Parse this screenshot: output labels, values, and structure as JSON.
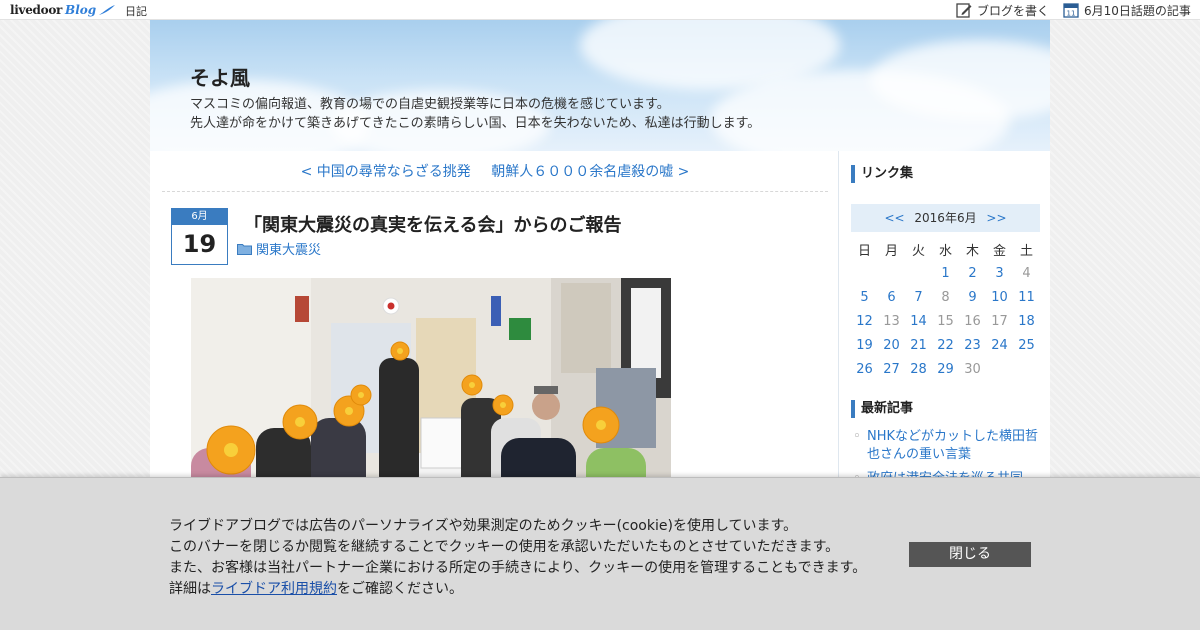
{
  "topbar": {
    "brand_livedoor": "livedoor",
    "brand_blog": "Blog",
    "nav_diary": "日記",
    "write_label": "ブログを書く",
    "topic_label": "6月10日話題の記事",
    "topic_icon_day": "11"
  },
  "header": {
    "title": "そよ風",
    "desc_line1": "マスコミの偏向報道、教育の場での自虐史観授業等に日本の危機を感じています。",
    "desc_line2": "先人達が命をかけて築きあげてきたこの素晴らしい国、日本を失わないため、私達は行動します。"
  },
  "pager": {
    "prev": "< 中国の尋常ならざる挑発",
    "next": "朝鮮人６０００余名虐殺の嘘 >"
  },
  "article": {
    "month": "6月",
    "day": "19",
    "title": "「関東大震災の真実を伝える会」からのご報告",
    "category": "関東大震災"
  },
  "sidebar": {
    "links_heading": "リンク集",
    "calendar": {
      "prev": "<<",
      "title": "2016年6月",
      "next": ">>",
      "weekdays": [
        "日",
        "月",
        "火",
        "水",
        "木",
        "金",
        "土"
      ]
    },
    "recent_heading": "最新記事",
    "recent": [
      "NHKなどがカットした横田哲也さんの重い言葉",
      "政府は港安全法を巡る共同"
    ]
  },
  "cookie": {
    "line1": "ライブドアブログでは広告のパーソナライズや効果測定のためクッキー(cookie)を使用しています。",
    "line2": "このバナーを閉じるか閲覧を継続することでクッキーの使用を承認いただいたものとさせていただきます。",
    "line3": "また、お客様は当社パートナー企業における所定の手続きにより、クッキーの使用を管理することもできます。",
    "line4_pre": "詳細は",
    "line4_link": "ライブドア利用規約",
    "line4_post": "をご確認ください。",
    "close": "閉じる"
  },
  "colors": {
    "accent": "#3a7cc0",
    "link": "#2a77c9",
    "cookie_bg": "#dadada",
    "close_bg": "#555555"
  }
}
